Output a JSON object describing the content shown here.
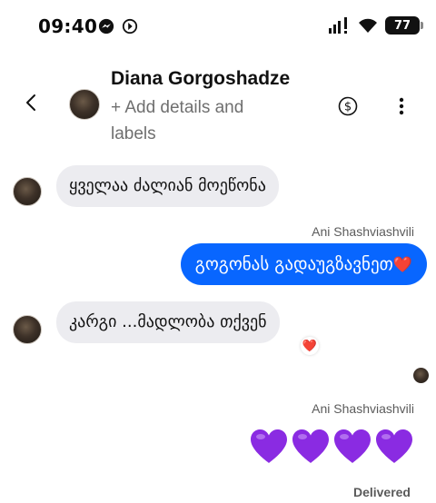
{
  "status_bar": {
    "time": "09:40",
    "battery": "77",
    "left_icons": [
      "messenger-icon",
      "data-saver-icon"
    ],
    "right_icons": [
      "signal-icon",
      "wifi-icon",
      "battery-icon"
    ]
  },
  "header": {
    "contact_name": "Diana Gorgoshadze",
    "subtitle": "+ Add details and labels",
    "icons": [
      "back-icon",
      "contact-avatar",
      "dollar-icon",
      "more-icon"
    ]
  },
  "messages": [
    {
      "direction": "incoming",
      "text": "ყველაა ძალიან მოეწონა"
    },
    {
      "direction": "outgoing",
      "sender": "Ani Shashviashvili",
      "text": "გოგონას გადაუგზავნეთ",
      "emoji": "❤️"
    },
    {
      "direction": "incoming",
      "text": "კარგი ...მადლობა თქვენ",
      "reaction": "❤️"
    },
    {
      "direction": "outgoing",
      "sender": "Ani Shashviashvili",
      "emoji": "💜💜💜💜"
    }
  ],
  "status": {
    "delivered": "Delivered"
  },
  "colors": {
    "outgoing_bubble": "#0866ff",
    "incoming_bubble": "#ececf0",
    "heart_purple": "#8a2be2",
    "heart_red": "#e8112d"
  }
}
